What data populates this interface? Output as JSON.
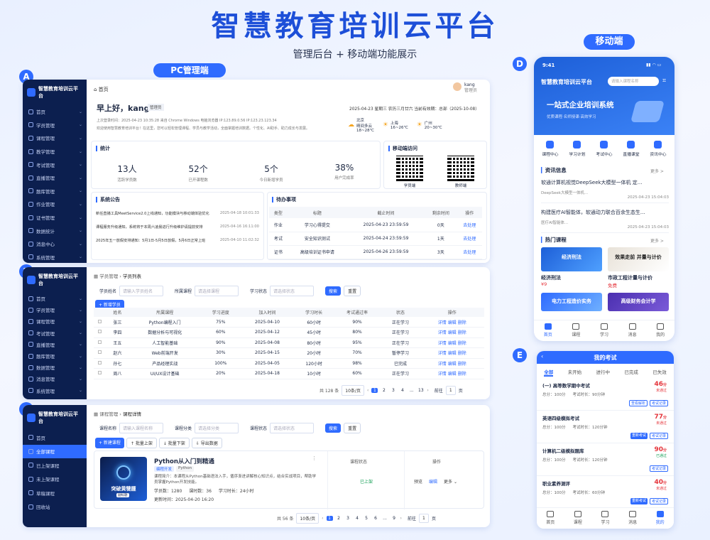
{
  "hero": {
    "title": "智慧教育培训云平台",
    "subtitle": "管理后台 + 移动端功能展示",
    "pc_label": "PC管理端",
    "mobile_label": "移动端"
  },
  "letters": [
    "A",
    "B",
    "C",
    "D",
    "E"
  ],
  "a": {
    "brand": "智慧教育培训云平台",
    "menu": [
      "首页",
      "学员管理",
      "课程管理",
      "教学管理",
      "考试管理",
      "直播管理",
      "题库管理",
      "作业管理",
      "证书管理",
      "数据统计",
      "消息中心",
      "系统管理"
    ],
    "crumb_home": "首页",
    "user": "kang",
    "user_role": "管理员",
    "greet": "早上好，kang",
    "greet_tag": "管理员",
    "date": "2025-04-23 星期三 农历三月廿六 当前有效期：总部（2025-10-08）",
    "last_login": "上次登录时间：2025-04-23 10:35:28 来自 Chrome Windows 电脑浏览器 IP:123.89.0.56 IP:123.23.123.34",
    "welcome": "欢迎使用智慧教育培训平台！在这里，您可以轻松管理课程、学员与教学活动，全面掌握培训数据。个性化、AI助手、助力成长与发展。",
    "weather": [
      {
        "city": "北京",
        "desc": "晴间多云",
        "temp": "18~28℃"
      },
      {
        "city": "上海",
        "desc": "",
        "temp": "16~26℃"
      },
      {
        "city": "广州",
        "desc": "",
        "temp": "20~30℃"
      }
    ],
    "stats_title": "统计",
    "stats": [
      {
        "v": "13人",
        "l": "活跃学员数"
      },
      {
        "v": "52个",
        "l": "已开课程数"
      },
      {
        "v": "5个",
        "l": "今日新增学员"
      },
      {
        "v": "38%",
        "l": "用户完成率"
      }
    ],
    "mobile_title": "移动端访问",
    "qr": [
      "学员端",
      "教师端"
    ],
    "notice_title": "系统公告",
    "notices": [
      {
        "t": "新任直播工具MeetService2.0上线通知，功能模块与移动端体验优化",
        "d": "2025-04-18 10:01:33"
      },
      {
        "t": "课程服务升级通知，系统将于本周六凌晨进行升级维护请提前安排",
        "d": "2025-04-16 16:11:00"
      },
      {
        "t": "2025年五一放假安排通知：5月1日-5月5日放假，5月6日正常上班",
        "d": "2025-04-10 11:02:32"
      }
    ],
    "todo_title": "待办事项",
    "todo_head": [
      "类型",
      "标题",
      "截止时间",
      "剩余时间",
      "操作"
    ],
    "todos": [
      [
        "作业",
        "学习心得提交",
        "2025-04-23 23:59:59",
        "0天",
        "去处理"
      ],
      [
        "考试",
        "安全知识测试",
        "2025-04-24 23:59:59",
        "1天",
        "去处理"
      ],
      [
        "证书",
        "高级培训证书申请",
        "2025-04-26 23:59:59",
        "3天",
        "去处理"
      ]
    ]
  },
  "b": {
    "brand": "智慧教育培训云平台",
    "menu": [
      "首页",
      "学员管理",
      "课程管理",
      "考试管理",
      "直播管理",
      "题库管理",
      "数据管理",
      "消息管理",
      "系统管理"
    ],
    "crumb1": "学员管理",
    "crumb2": "学员列表",
    "filters": [
      {
        "l": "学员姓名",
        "p": "请输入学员姓名"
      },
      {
        "l": "所属课程",
        "p": "请选择课程"
      },
      {
        "l": "学习状态",
        "p": "请选择状态"
      }
    ],
    "search": "搜索",
    "reset": "重置",
    "add": "+ 新增学员",
    "head": [
      "",
      "姓名",
      "所属课程",
      "学习进度",
      "加入时间",
      "学习时长",
      "考试通过率",
      "状态",
      "操作"
    ],
    "rows": [
      [
        "张三",
        "Python编程入门",
        "75%",
        "2025-04-10",
        "60小时",
        "90%",
        "正在学习"
      ],
      [
        "李四",
        "数据分析与可视化",
        "60%",
        "2025-04-12",
        "45小时",
        "80%",
        "正在学习"
      ],
      [
        "王五",
        "人工智能基础",
        "90%",
        "2025-04-08",
        "80小时",
        "95%",
        "正在学习"
      ],
      [
        "赵六",
        "Web前端开发",
        "30%",
        "2025-04-15",
        "20小时",
        "70%",
        "暂停学习"
      ],
      [
        "孙七",
        "产品经理实战",
        "100%",
        "2025-04-05",
        "120小时",
        "98%",
        "已完成"
      ],
      [
        "周八",
        "UI/UX设计基础",
        "20%",
        "2025-04-18",
        "10小时",
        "60%",
        "正在学习"
      ]
    ],
    "ops": [
      "详情",
      "编辑",
      "删除"
    ],
    "total": "共 128 条",
    "per": "10条/页",
    "pages": [
      "1",
      "2",
      "3",
      "4",
      "...",
      "13"
    ],
    "goto": "前往",
    "goto_v": "1",
    "goto_u": "页"
  },
  "c": {
    "brand": "智慧教育培训云平台",
    "menu": [
      "首页",
      "全部课程",
      "已上架课程",
      "未上架课程",
      "草稿课程",
      "回收站"
    ],
    "crumb1": "课程管理",
    "crumb2": "课程详情",
    "filters": [
      {
        "l": "课程名称",
        "p": "请输入课程名称"
      },
      {
        "l": "课程分类",
        "p": "请选择分类"
      },
      {
        "l": "课程状态",
        "p": "请选择状态"
      }
    ],
    "search": "搜索",
    "reset": "重置",
    "actions": [
      "+ 新建课程",
      "↑ 批量上架",
      "↓ 批量下架",
      "⇩ 导出数据"
    ],
    "course": {
      "title": "Python从入门到精通",
      "tags": [
        "编程开发",
        "Python"
      ],
      "cover_text": "突破黄犍腫",
      "cover_sub": "副标题",
      "intro": "课程简介：本课程从Python基础语法入手，循序渐进讲解核心知识点，结合实战项目，帮助学员掌握Python开发技能。",
      "students": "学员数：1280",
      "hours": "课时数：36",
      "duration": "学习时长：24小时",
      "updated": "更新时间：2025-04-20 16:20"
    },
    "status_h": "课程状态",
    "status": "已上架",
    "ops_h": "操作",
    "ops": [
      "预览",
      "编辑",
      "更多 ⌄"
    ],
    "total": "共 56 条",
    "per": "10条/页",
    "pages": [
      "1",
      "2",
      "3",
      "4",
      "5",
      "6",
      "...",
      "9"
    ],
    "goto": "前往",
    "goto_v": "1",
    "goto_u": "页"
  },
  "d": {
    "time": "9:41",
    "brand": "智慧教育培训云平台",
    "search": "请输入课程名称",
    "banner": "一站式企业培训系统",
    "banner_sub": "优质课程·名师授课·高效学习",
    "quick": [
      "课程中心",
      "学习计划",
      "考试中心",
      "直播课堂",
      "资讯中心"
    ],
    "news_title": "资讯信息",
    "more": "更多 >",
    "news": [
      {
        "t": "软通计算机视觉DeepSeek大模型一体机 定...",
        "s": "DeepSeek大模型一体机...",
        "d": "2025-04-23 15:04:03"
      },
      {
        "t": "构建医疗AI智能体，软通动力联合百余生态生...",
        "s": "医疗AI智能体...",
        "d": "2025-04-23 15:04:03"
      }
    ],
    "hot_title": "热门课程",
    "courses": [
      {
        "img": "经济刑法",
        "name": "经济刑法",
        "price": "¥9"
      },
      {
        "img": "效果走前 并量与计价",
        "name": "市政工程计量与计价",
        "price": "免费"
      },
      {
        "img": "电力工程造价实务",
        "name": "",
        "price": ""
      },
      {
        "img": "高级财务会计学",
        "name": "",
        "price": ""
      }
    ],
    "nav": [
      "首页",
      "课程",
      "学习",
      "消息",
      "我的"
    ]
  },
  "e": {
    "title": "我的考试",
    "tabs": [
      "全部",
      "未开始",
      "进行中",
      "已完成",
      "已失效"
    ],
    "exams": [
      {
        "n": "(一) 高等数学期中考试",
        "s": "总分：100分",
        "t": "考试时长：90分钟",
        "score": "46",
        "unit": "分",
        "st": "未通过",
        "btn": [
          "查看解析",
          "考试记录"
        ]
      },
      {
        "n": "英语四级模拟考试",
        "s": "总分：100分",
        "t": "考试时长：120分钟",
        "score": "77",
        "unit": "分",
        "st": "未通过",
        "btn": [
          "重新考试",
          "考试记录"
        ]
      },
      {
        "n": "计算机二级模拟题库",
        "s": "总分：100分",
        "t": "考试时长：120分钟",
        "score": "90",
        "unit": "分",
        "st": "已通过",
        "btn": [
          "考试记录"
        ]
      },
      {
        "n": "职业素养测评",
        "s": "总分：100分",
        "t": "考试时长：60分钟",
        "score": "40",
        "unit": "分",
        "st": "未通过",
        "btn": [
          "重新考试",
          "考试记录"
        ]
      }
    ],
    "nav": [
      "首页",
      "课程",
      "学习",
      "消息",
      "我的"
    ]
  }
}
